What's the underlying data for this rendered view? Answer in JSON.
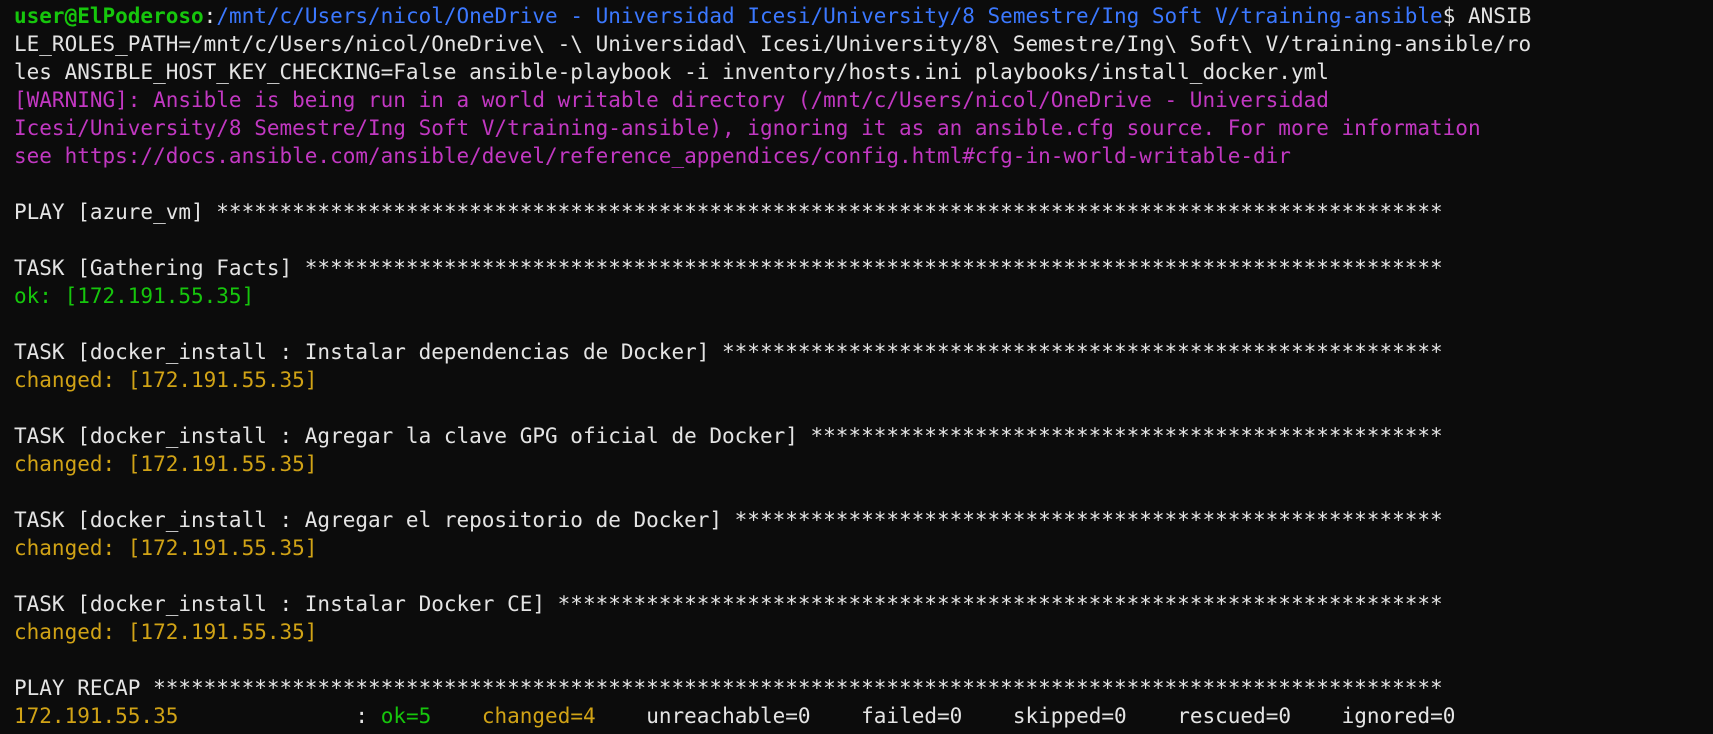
{
  "colors": {
    "background": "#0c0c0c",
    "foreground": "#cccccc",
    "prompt_user": "#16c60c",
    "prompt_path": "#3b78ff",
    "warning": "#c238c2",
    "ok": "#16c60c",
    "changed": "#d1a316"
  },
  "prompt": {
    "user": "user@ElPoderoso",
    "sep": ":",
    "path": "/mnt/c/Users/nicol/OneDrive - Universidad Icesi/University/8 Semestre/Ing Soft V/training-ansible",
    "symbol": "$ ",
    "command_lines": [
      "ANSIB",
      "LE_ROLES_PATH=/mnt/c/Users/nicol/OneDrive\\ -\\ Universidad\\ Icesi/University/8\\ Semestre/Ing\\ Soft\\ V/training-ansible/ro",
      "les ANSIBLE_HOST_KEY_CHECKING=False ansible-playbook -i inventory/hosts.ini playbooks/install_docker.yml"
    ]
  },
  "warning_lines": [
    "[WARNING]: Ansible is being run in a world writable directory (/mnt/c/Users/nicol/OneDrive - Universidad",
    "Icesi/University/8 Semestre/Ing Soft V/training-ansible), ignoring it as an ansible.cfg source. For more information",
    "see https://docs.ansible.com/ansible/devel/reference_appendices/config.html#cfg-in-world-writable-dir"
  ],
  "play": {
    "header": "PLAY [azure_vm] *************************************************************************************************"
  },
  "tasks": [
    {
      "header": "TASK [Gathering Facts] ******************************************************************************************",
      "result": "ok: [172.191.55.35]",
      "status": "ok"
    },
    {
      "header": "TASK [docker_install : Instalar dependencias de Docker] *********************************************************",
      "result": "changed: [172.191.55.35]",
      "status": "changed"
    },
    {
      "header": "TASK [docker_install : Agregar la clave GPG oficial de Docker] **************************************************",
      "result": "changed: [172.191.55.35]",
      "status": "changed"
    },
    {
      "header": "TASK [docker_install : Agregar el repositorio de Docker] ********************************************************",
      "result": "changed: [172.191.55.35]",
      "status": "changed"
    },
    {
      "header": "TASK [docker_install : Instalar Docker CE] **********************************************************************",
      "result": "changed: [172.191.55.35]",
      "status": "changed"
    }
  ],
  "recap": {
    "header": "PLAY RECAP ******************************************************************************************************",
    "host": "172.191.55.35",
    "host_pad": "              ",
    "colon": ": ",
    "ok": "ok=5",
    "gap1": "    ",
    "changed": "changed=4",
    "rest": "    unreachable=0    failed=0    skipped=0    rescued=0    ignored=0"
  }
}
